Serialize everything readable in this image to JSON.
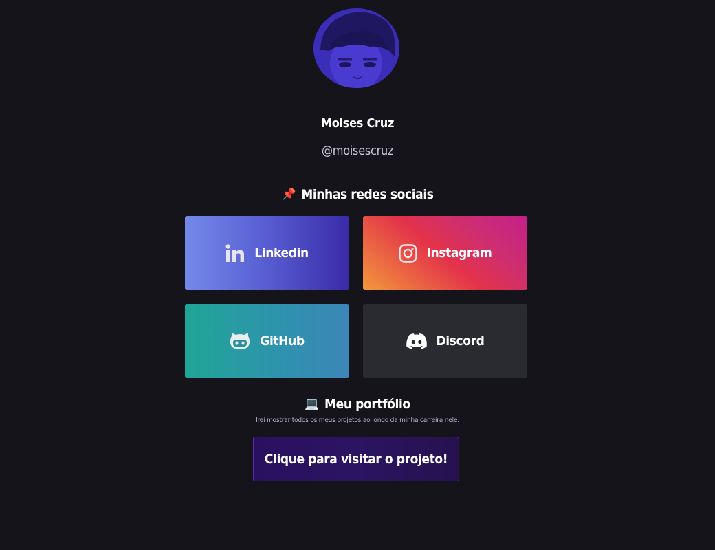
{
  "profile": {
    "name": "Moises Cruz",
    "handle": "@moisescruz",
    "avatar_tint": "#3b2ec0"
  },
  "social": {
    "emoji": "📌",
    "title": "Minhas redes sociais",
    "links": [
      {
        "label": "Linkedin",
        "icon": "linkedin-icon",
        "color_start": "#7489ea",
        "color_end": "#3a2ba8"
      },
      {
        "label": "Instagram",
        "icon": "instagram-icon",
        "color_start": "#f2993b",
        "color_end": "#c4208a"
      },
      {
        "label": "GitHub",
        "icon": "github-icon",
        "color_start": "#20a597",
        "color_end": "#3c86b8"
      },
      {
        "label": "Discord",
        "icon": "discord-icon",
        "color_start": "#2a2b30",
        "color_end": "#2a2b30"
      }
    ]
  },
  "portfolio": {
    "emoji": "💻",
    "title": "Meu portfólio",
    "description": "Irei mostrar todos os meus projetos ao longo da minha carreira nele.",
    "button_label": "Clique para visitar o projeto!",
    "accent": "#5b2ab8"
  },
  "theme": {
    "background": "#15141a"
  }
}
